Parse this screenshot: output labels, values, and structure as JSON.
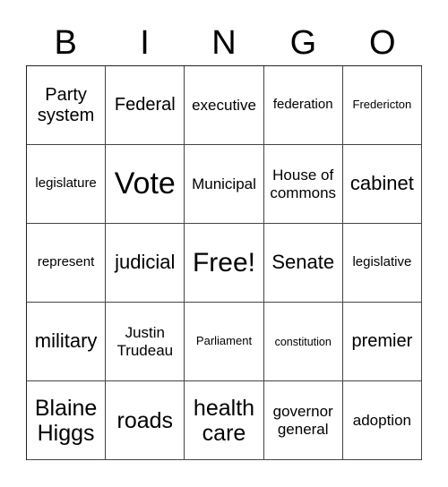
{
  "header": {
    "letters": [
      "B",
      "I",
      "N",
      "G",
      "O"
    ]
  },
  "grid": {
    "rows": [
      [
        "Party system",
        "Federal",
        "executive",
        "federation",
        "Fredericton"
      ],
      [
        "legislature",
        "Vote",
        "Municipal",
        "House of commons",
        "cabinet"
      ],
      [
        "represent",
        "judicial",
        "Free!",
        "Senate",
        "legislative"
      ],
      [
        "military",
        "Justin Trudeau",
        "Parliament",
        "constitution",
        "premier"
      ],
      [
        "Blaine Higgs",
        "roads",
        "health care",
        "governor general",
        "adoption"
      ]
    ]
  }
}
